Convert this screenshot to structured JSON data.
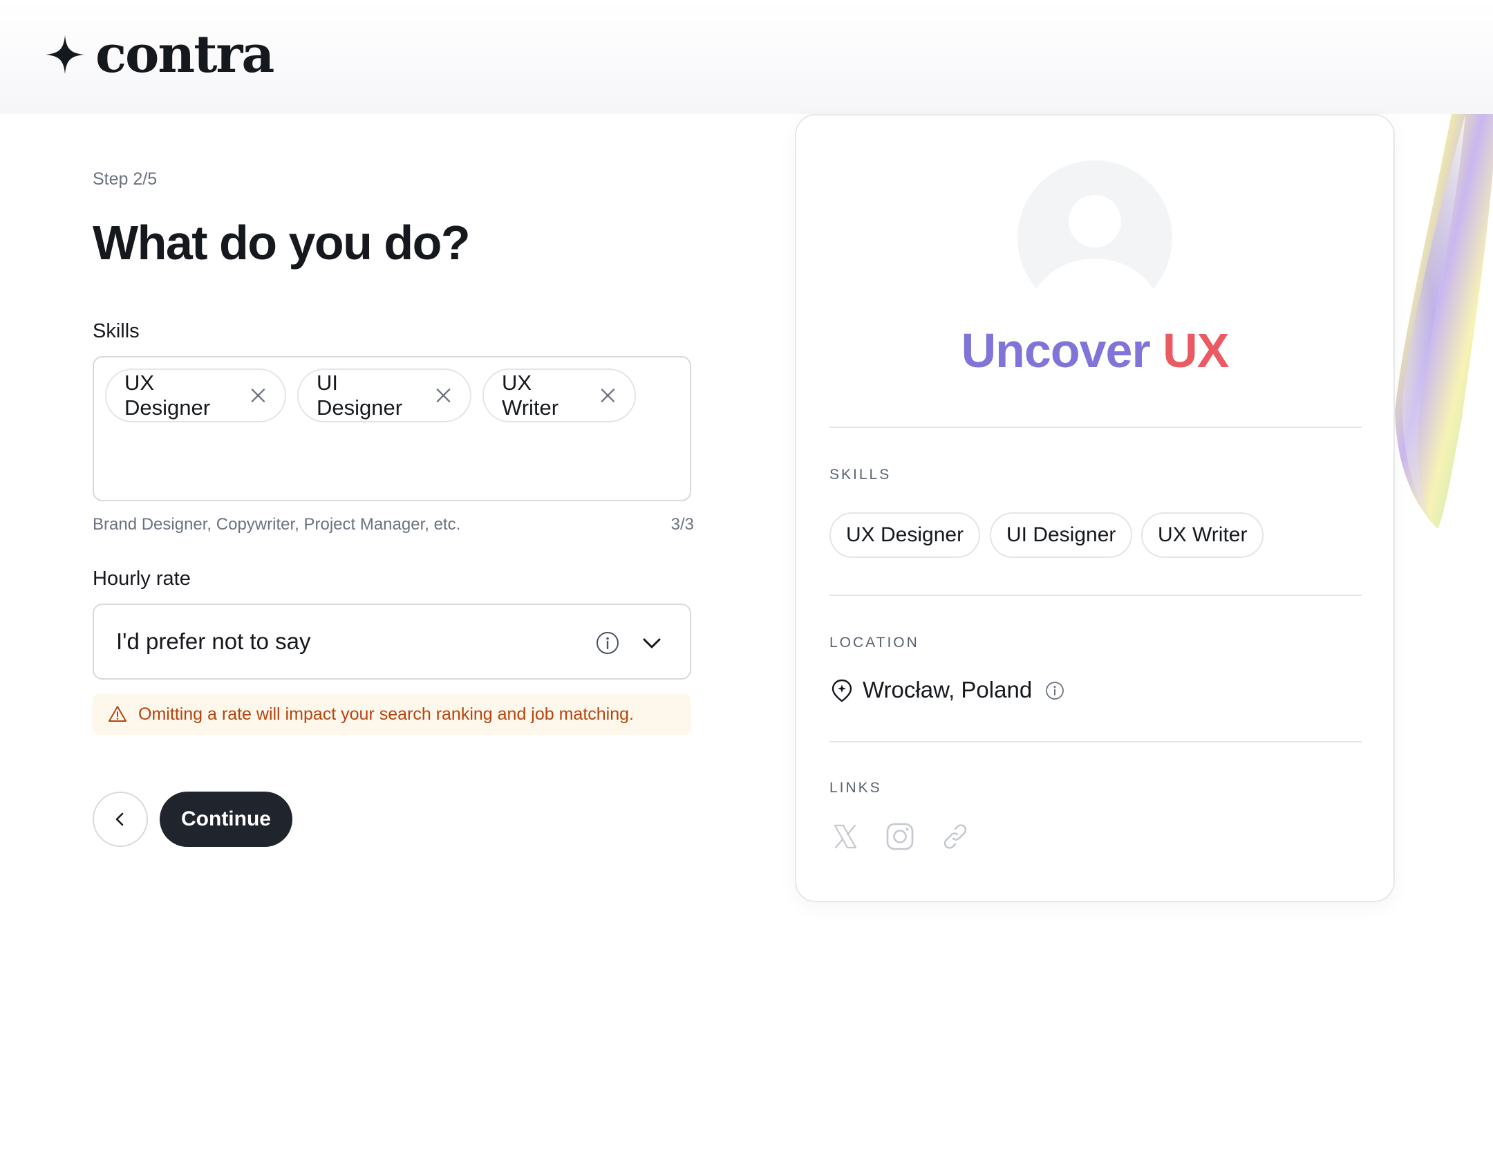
{
  "brand": {
    "name": "contra"
  },
  "form": {
    "step": "Step 2/5",
    "heading": "What do you do?",
    "skills_label": "Skills",
    "skills": [
      "UX Designer",
      "UI Designer",
      "UX Writer"
    ],
    "skills_hint": "Brand Designer, Copywriter, Project Manager, etc.",
    "skills_count": "3/3",
    "rate_label": "Hourly rate",
    "rate_value": "I'd prefer not to say",
    "warning": "Omitting a rate will impact your search ranking and job matching.",
    "continue_label": "Continue"
  },
  "profile_card": {
    "name_first": "Uncover",
    "name_second": "UX",
    "skills_title": "SKILLS",
    "skills": [
      "UX Designer",
      "UI Designer",
      "UX Writer"
    ],
    "location_title": "LOCATION",
    "location": "Wrocław, Poland",
    "links_title": "LINKS",
    "links": [
      "x-icon",
      "instagram-icon",
      "link-icon"
    ]
  },
  "colors": {
    "primary_button": "#20242c",
    "warning_text": "#b5440f",
    "warning_bg": "#fef8ec",
    "name_gradient_start": "#8174d8",
    "name_gradient_end": "#ea5a63"
  }
}
